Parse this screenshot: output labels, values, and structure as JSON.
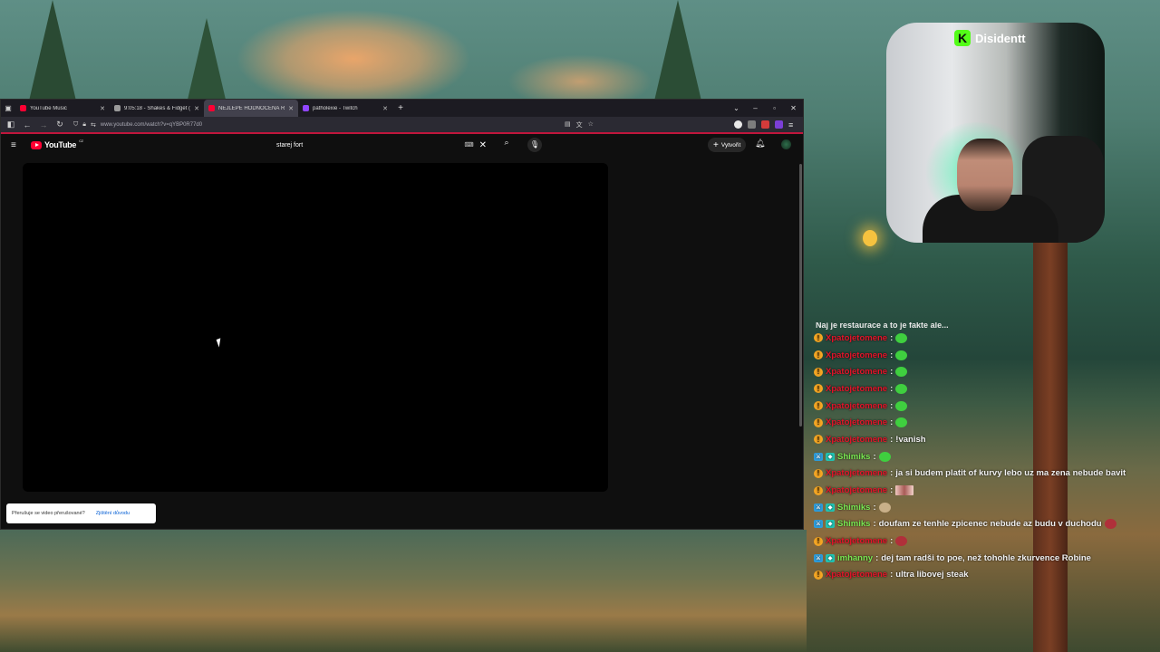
{
  "browser": {
    "tabs": [
      {
        "label": "YouTube Music",
        "favicon_color": "#ff0033",
        "active": false
      },
      {
        "label": "9:05:18 - Shakes & Fidget (29.1",
        "favicon_color": "#9a9a9a",
        "active": false
      },
      {
        "label": "NEJLEPE HODNOCENÁ RESTAU",
        "favicon_color": "#ff0033",
        "active": true
      },
      {
        "label": "patholexie - Twitch",
        "favicon_color": "#9146ff",
        "active": false
      }
    ],
    "url": "www.youtube.com/watch?v=qYBP0R77d0"
  },
  "youtube": {
    "logo_text": "YouTube",
    "country_code": "CZ",
    "search_query": "starej fort",
    "create_label": "Vytvořit"
  },
  "toast": {
    "message": "Přerušuje se video přerušované?",
    "link": "Zjištění důvodu"
  },
  "stream": {
    "streamer_badge": "K",
    "streamer_name": "Disidentt",
    "brand_color": "#53fc18"
  },
  "chat": {
    "cut_line": "Naj je restaurace a to je fakte ale...",
    "messages": [
      {
        "user": "Xpatojetomene",
        "user_color": "red",
        "badges": [
          "warn"
        ],
        "text": "",
        "emote": "green"
      },
      {
        "user": "Xpatojetomene",
        "user_color": "red",
        "badges": [
          "warn"
        ],
        "text": "",
        "emote": "green"
      },
      {
        "user": "Xpatojetomene",
        "user_color": "red",
        "badges": [
          "warn"
        ],
        "text": "",
        "emote": "green"
      },
      {
        "user": "Xpatojetomene",
        "user_color": "red",
        "badges": [
          "warn"
        ],
        "text": "",
        "emote": "green"
      },
      {
        "user": "Xpatojetomene",
        "user_color": "red",
        "badges": [
          "warn"
        ],
        "text": "",
        "emote": "green"
      },
      {
        "user": "Xpatojetomene",
        "user_color": "red",
        "badges": [
          "warn"
        ],
        "text": "",
        "emote": "green"
      },
      {
        "user": "Xpatojetomene",
        "user_color": "red",
        "badges": [
          "warn"
        ],
        "text": "!vanish",
        "emote": ""
      },
      {
        "user": "Shimiks",
        "user_color": "green",
        "badges": [
          "mod",
          "sub"
        ],
        "text": "",
        "emote": "green"
      },
      {
        "user": "Xpatojetomene",
        "user_color": "red",
        "badges": [
          "warn"
        ],
        "text": "ja si budem platit of kurvy lebo uz ma zena nebude bavit",
        "emote": ""
      },
      {
        "user": "Xpatojetomene",
        "user_color": "red",
        "badges": [
          "warn"
        ],
        "text": "",
        "emote": "img"
      },
      {
        "user": "Shimiks",
        "user_color": "green",
        "badges": [
          "mod",
          "sub"
        ],
        "text": "",
        "emote": "round"
      },
      {
        "user": "Shimiks",
        "user_color": "green",
        "badges": [
          "mod",
          "sub"
        ],
        "text": "doufam ze tenhle zpicenec nebude az budu v duchodu",
        "emote": "red"
      },
      {
        "user": "Xpatojetomene",
        "user_color": "red",
        "badges": [
          "warn"
        ],
        "text": "",
        "emote": "red"
      },
      {
        "user": "imhanny",
        "user_color": "green",
        "badges": [
          "mod",
          "sub"
        ],
        "text": "dej tam radši to poe, než tohohle zkurvence Robine",
        "emote": ""
      },
      {
        "user": "Xpatojetomene",
        "user_color": "red",
        "badges": [
          "warn"
        ],
        "text": "ultra libovej steak",
        "emote": ""
      }
    ]
  }
}
